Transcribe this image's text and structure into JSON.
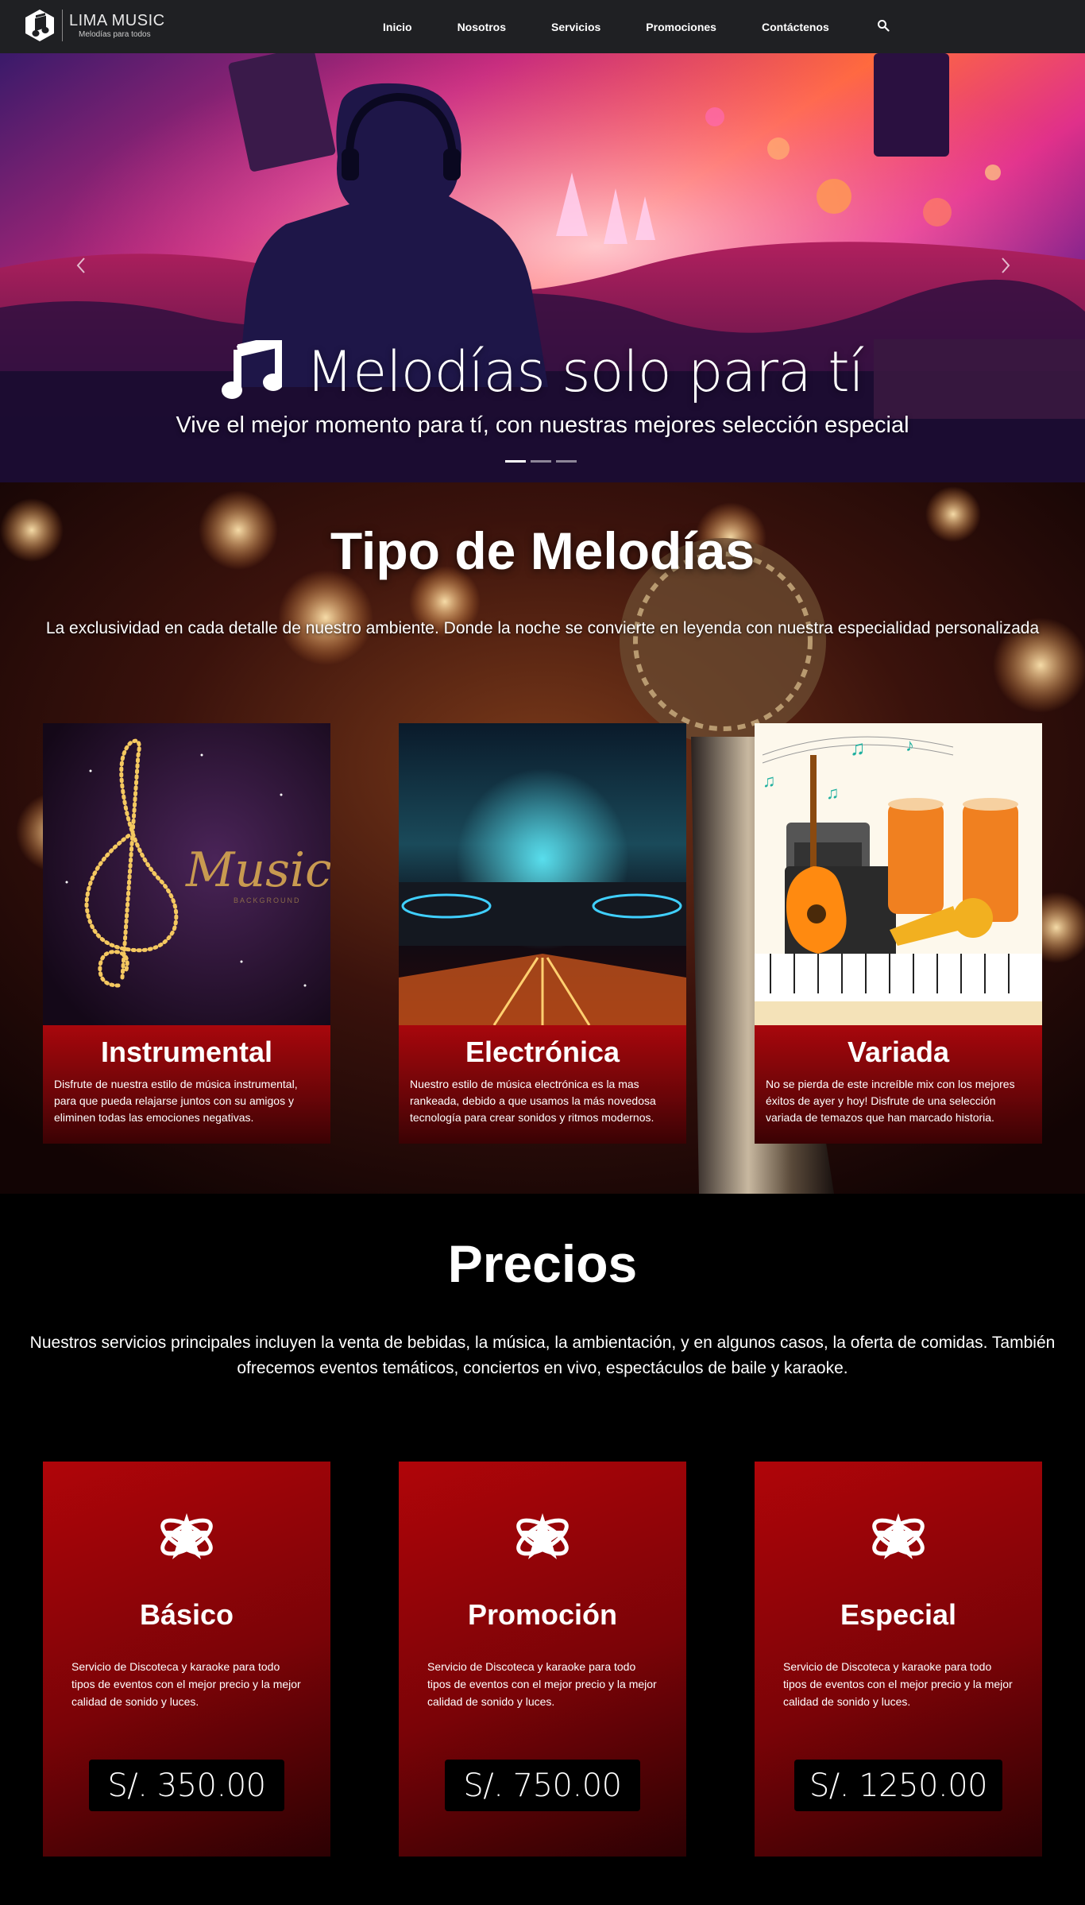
{
  "brand": {
    "name": "LIMA MUSIC",
    "tagline": "Melodías para todos"
  },
  "nav": {
    "items": [
      {
        "label": "Inicio"
      },
      {
        "label": "Nosotros"
      },
      {
        "label": "Servicios"
      },
      {
        "label": "Promociones"
      },
      {
        "label": "Contáctenos"
      }
    ],
    "search_icon": "search-icon"
  },
  "hero": {
    "title": "Melodías solo para tí",
    "subtitle": "Vive el mejor momento para tí, con nuestras mejores selección especial",
    "icon": "music-note-icon",
    "slides": 3,
    "active_slide": 1
  },
  "tipos": {
    "title": "Tipo de Melodías",
    "description": "La exclusividad en cada detalle de nuestro ambiente. Donde la noche se convierte en leyenda con nuestra especialidad personalizada",
    "cards": [
      {
        "title": "Instrumental",
        "text": "Disfrute de nuestra estilo de música instrumental, para que pueda relajarse juntos con su amigos y eliminen todas las emociones negativas.",
        "image_text": "Music",
        "image_subtext": "BACKGROUND"
      },
      {
        "title": "Electrónica",
        "text": "Nuestro estilo de música electrónica es la mas rankeada, debido a que usamos la más novedosa tecnología para crear sonidos y ritmos modernos."
      },
      {
        "title": "Variada",
        "text": "No se pierda de este increíble mix con los mejores éxitos de ayer y hoy! Disfrute de una selección variada de temazos que han marcado historia."
      }
    ]
  },
  "precios": {
    "title": "Precios",
    "description": "Nuestros servicios principales incluyen la venta de bebidas, la música, la ambientación, y en algunos casos, la oferta de comidas. También ofrecemos eventos temáticos, conciertos en vivo, espectáculos de baile y karaoke.",
    "plans": [
      {
        "title": "Básico",
        "text": "Servicio de Discoteca y karaoke para todo tipos de eventos con el mejor precio y la mejor calidad de sonido y luces.",
        "price": "S/. 350.00"
      },
      {
        "title": "Promoción",
        "text": "Servicio de Discoteca y karaoke para todo tipos de eventos con el mejor precio y la mejor calidad de sonido y luces.",
        "price": "S/. 750.00"
      },
      {
        "title": "Especial",
        "text": "Servicio de Discoteca y karaoke para todo tipos de eventos con el mejor precio y la mejor calidad de sonido y luces.",
        "price": "S/. 1250.00"
      }
    ]
  },
  "colors": {
    "navbar": "#1f2023",
    "card_red": "#a8070c",
    "price_bg": "#000000",
    "page_bg": "#000000"
  }
}
